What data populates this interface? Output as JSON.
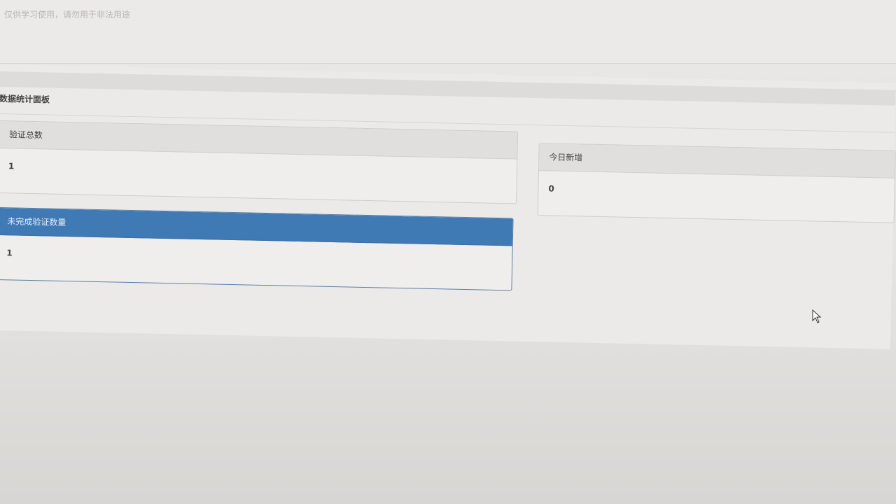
{
  "disclaimer": "仅供学习使用，请勿用于非法用途",
  "dashboard": {
    "title": "数据统计面板",
    "panels": {
      "total": {
        "label": "验证总数",
        "value": "1"
      },
      "today": {
        "label": "今日新增",
        "value": "0"
      },
      "incomplete": {
        "label": "未完成验证数量",
        "value": "1"
      }
    }
  },
  "colors": {
    "primary_panel_header": "#3f7ab5",
    "page_background": "#eceae8"
  },
  "icons": {
    "cursor": "mouse-pointer-icon"
  }
}
